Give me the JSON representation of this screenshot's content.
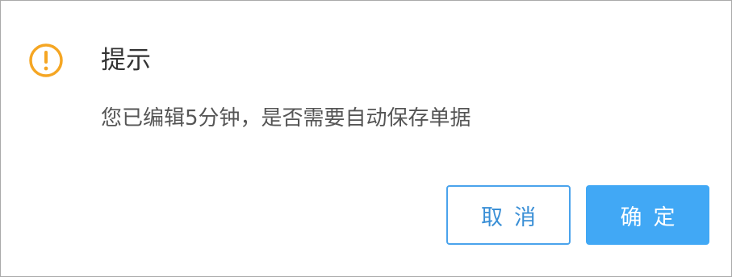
{
  "dialog": {
    "icon": "exclamation-circle-icon",
    "icon_color": "#f5a623",
    "title": "提示",
    "message": "您已编辑5分钟，是否需要自动保存单据",
    "cancel_label": "取消",
    "confirm_label": "确定",
    "accent_color": "#41a8f5"
  }
}
